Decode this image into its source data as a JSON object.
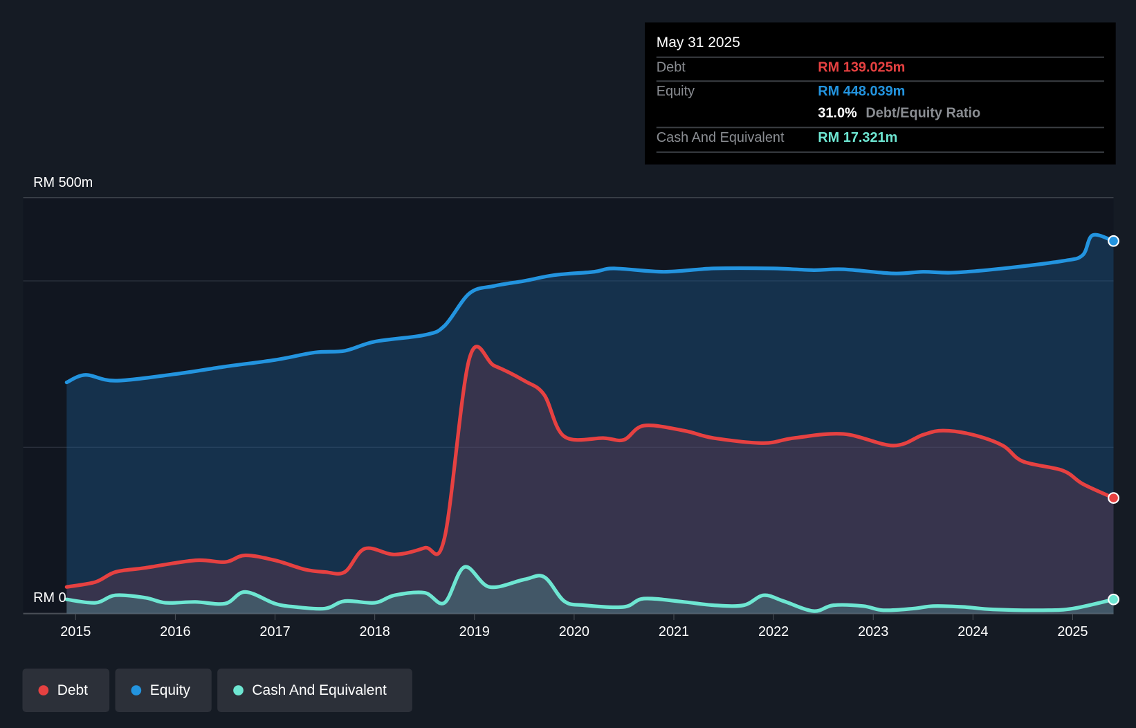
{
  "chart_data": {
    "type": "area",
    "y_axis_labels": [
      "RM 500m",
      "RM 0"
    ],
    "ylim": [
      0,
      500
    ],
    "xlim": [
      2014.91,
      2025.41
    ],
    "x_ticks": [
      "2015",
      "2016",
      "2017",
      "2018",
      "2019",
      "2020",
      "2021",
      "2022",
      "2023",
      "2024",
      "2025"
    ],
    "grid": true,
    "legend_placement": "bottom-left",
    "series": [
      {
        "name": "Equity",
        "color": "#2394df",
        "x": [
          2014.91,
          2015.1,
          2015.4,
          2016,
          2016.5,
          2017,
          2017.4,
          2017.7,
          2018,
          2018.5,
          2018.7,
          2018.95,
          2019.2,
          2019.5,
          2019.8,
          2020.2,
          2020.4,
          2020.9,
          2021.4,
          2022,
          2022.4,
          2022.7,
          2023.2,
          2023.5,
          2023.8,
          2024.3,
          2024.9,
          2025.1,
          2025.2,
          2025.41
        ],
        "values": [
          278,
          287,
          280,
          288,
          297,
          305,
          314,
          316,
          327,
          335,
          346,
          385,
          394,
          400,
          407,
          411,
          415,
          411,
          415,
          415,
          413,
          414,
          409,
          411,
          410,
          415,
          424,
          431,
          455,
          448
        ]
      },
      {
        "name": "Debt",
        "color": "#e64141",
        "x": [
          2014.91,
          2015.2,
          2015.4,
          2015.7,
          2016.2,
          2016.5,
          2016.7,
          2017,
          2017.3,
          2017.5,
          2017.7,
          2017.9,
          2018.2,
          2018.5,
          2018.7,
          2018.95,
          2019.2,
          2019.5,
          2019.7,
          2019.9,
          2020.3,
          2020.5,
          2020.7,
          2021.1,
          2021.4,
          2021.9,
          2022.2,
          2022.7,
          2023.2,
          2023.5,
          2023.7,
          2024,
          2024.3,
          2024.5,
          2024.9,
          2025.1,
          2025.41
        ],
        "values": [
          32,
          38,
          50,
          55,
          64,
          62,
          70,
          64,
          53,
          50,
          50,
          78,
          71,
          79,
          91,
          307,
          298,
          280,
          263,
          213,
          211,
          209,
          226,
          220,
          211,
          205,
          211,
          216,
          202,
          215,
          220,
          215,
          202,
          183,
          172,
          156,
          139
        ]
      },
      {
        "name": "Cash And Equivalent",
        "color": "#6ee6d2",
        "x": [
          2014.91,
          2015.2,
          2015.4,
          2015.7,
          2015.9,
          2016.2,
          2016.5,
          2016.7,
          2017,
          2017.2,
          2017.5,
          2017.7,
          2018,
          2018.2,
          2018.5,
          2018.7,
          2018.9,
          2019.15,
          2019.5,
          2019.7,
          2019.9,
          2020.1,
          2020.5,
          2020.7,
          2021.1,
          2021.4,
          2021.7,
          2021.9,
          2022.1,
          2022.4,
          2022.6,
          2022.9,
          2023.1,
          2023.4,
          2023.6,
          2023.9,
          2024.2,
          2024.7,
          2025,
          2025.41
        ],
        "values": [
          17,
          13,
          22,
          19,
          13,
          14,
          12,
          26,
          12,
          8,
          6,
          15,
          13,
          22,
          25,
          13,
          56,
          32,
          41,
          44,
          15,
          10,
          8,
          18,
          14,
          10,
          10,
          22,
          15,
          3,
          10,
          9,
          4,
          6,
          9,
          8,
          5,
          4,
          6,
          17
        ]
      }
    ],
    "tooltip": {
      "date": "May 31 2025",
      "debt_label": "Debt",
      "debt_value": "RM 139.025m",
      "equity_label": "Equity",
      "equity_value": "RM 448.039m",
      "ratio_value": "31.0%",
      "ratio_label": "Debt/Equity Ratio",
      "cash_label": "Cash And Equivalent",
      "cash_value": "RM 17.321m"
    },
    "legend": [
      "Debt",
      "Equity",
      "Cash And Equivalent"
    ]
  }
}
